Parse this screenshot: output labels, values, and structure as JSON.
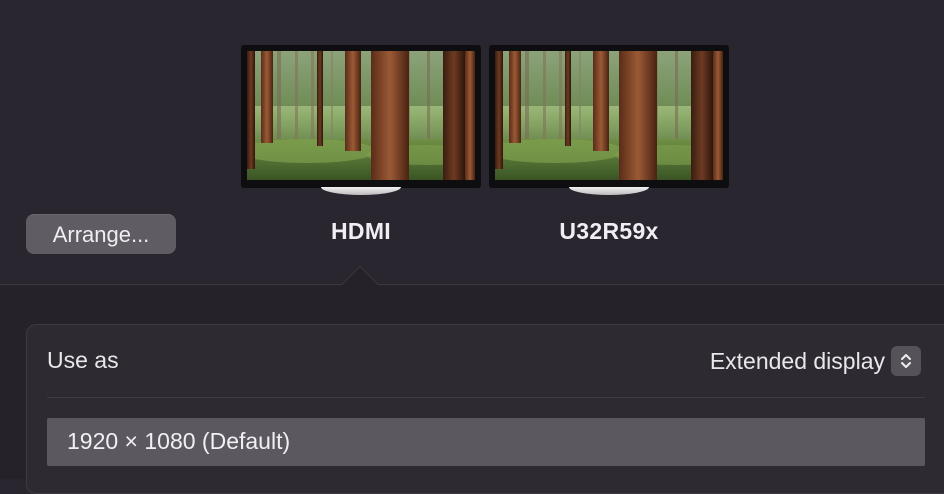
{
  "arrange_button": {
    "label": "Arrange..."
  },
  "displays": [
    {
      "name": "HDMI",
      "selected": true,
      "wallpaper": "forest-wallpaper"
    },
    {
      "name": "U32R59x",
      "selected": false,
      "wallpaper": "forest-wallpaper"
    }
  ],
  "settings": {
    "use_as": {
      "label": "Use as",
      "value": "Extended display"
    },
    "resolution": {
      "selected": "1920 × 1080 (Default)"
    }
  },
  "colors": {
    "background_top": "#2a2630",
    "background_bottom": "#252229",
    "panel": "#2d2a31",
    "button": "#5f5c63",
    "selected_row": "#5b5860"
  }
}
